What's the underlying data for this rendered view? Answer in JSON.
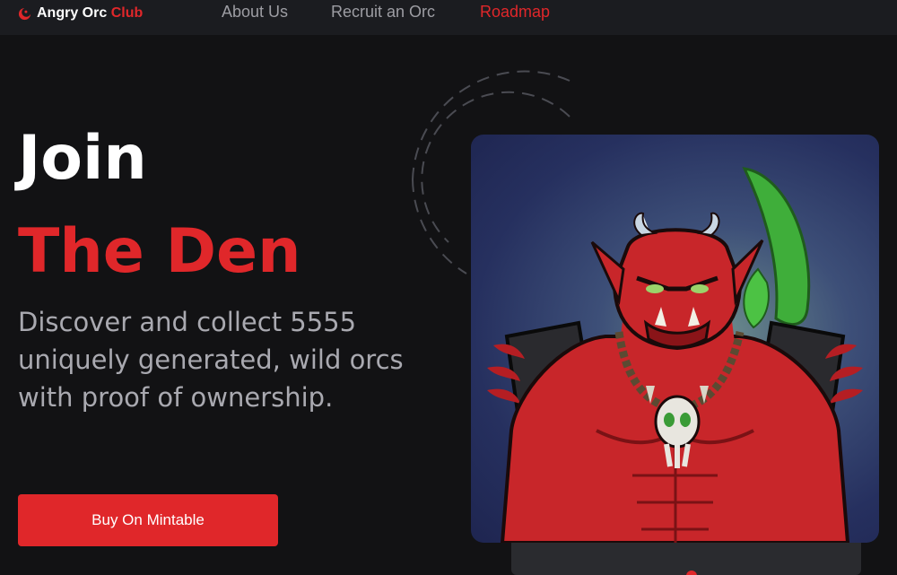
{
  "brand": {
    "name": "Angry Orc",
    "accent": "Club",
    "logo_icon": "crescent-logo-icon",
    "accent_color": "#e0272a"
  },
  "nav": {
    "items": [
      {
        "label": "About Us",
        "active": false
      },
      {
        "label": "Recruit an Orc",
        "active": false
      },
      {
        "label": "Roadmap",
        "active": true
      }
    ]
  },
  "hero": {
    "title_line1": "Join",
    "title_line2": "The Den",
    "description": "Discover and collect 5555 uniquely generated, wild orcs with proof of ownership.",
    "cta_label": "Buy On Mintable"
  },
  "colors": {
    "background": "#121214",
    "topbar": "#1b1c20",
    "accent": "#e0272a",
    "muted_text": "#a9a9b0"
  }
}
